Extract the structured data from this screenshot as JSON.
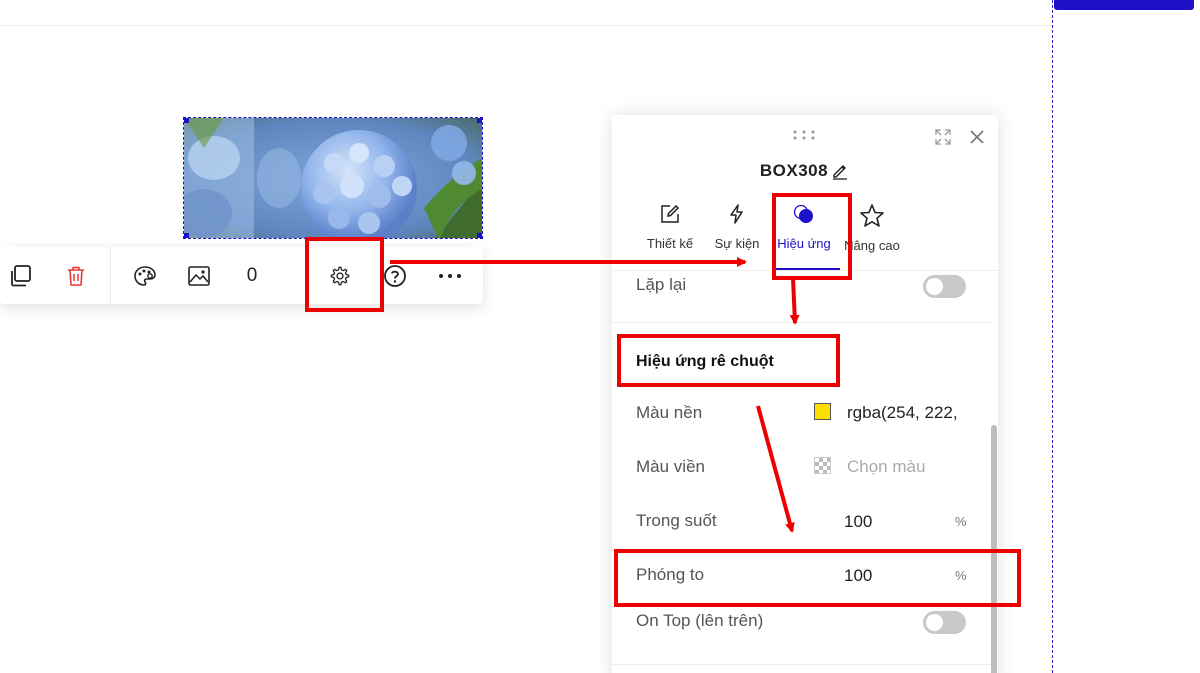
{
  "toolbar": {
    "count_value": "0",
    "icons": [
      "copy-icon",
      "delete-icon",
      "palette-icon",
      "image-icon",
      "settings-icon",
      "help-icon",
      "more-icon"
    ]
  },
  "panel": {
    "title": "BOX308",
    "tabs": [
      {
        "label": "Thiết kế",
        "icon": "edit-icon"
      },
      {
        "label": "Sự kiện",
        "icon": "lightning-icon"
      },
      {
        "label": "Hiệu ứng",
        "icon": "effect-icon",
        "active": true
      },
      {
        "label": "Nâng cao",
        "icon": "star-icon"
      }
    ],
    "repeat_label": "Lặp lại",
    "repeat_on": false,
    "section_title": "Hiệu ứng rê chuột",
    "bg_color_label": "Màu nền",
    "bg_color_value": "rgba(254, 222,",
    "bg_swatch": "#fede00",
    "border_color_label": "Màu viền",
    "border_color_placeholder": "Chọn màu",
    "opacity_label": "Trong suốt",
    "opacity_value": "100",
    "opacity_unit": "%",
    "zoom_label": "Phóng to",
    "zoom_value": "100",
    "zoom_unit": "%",
    "ontop_label": "On Top (lên trên)",
    "ontop_on": false
  },
  "colors": {
    "accent": "#1e10c8",
    "annotation_red": "#ee0000",
    "delete_red": "#e53935"
  }
}
